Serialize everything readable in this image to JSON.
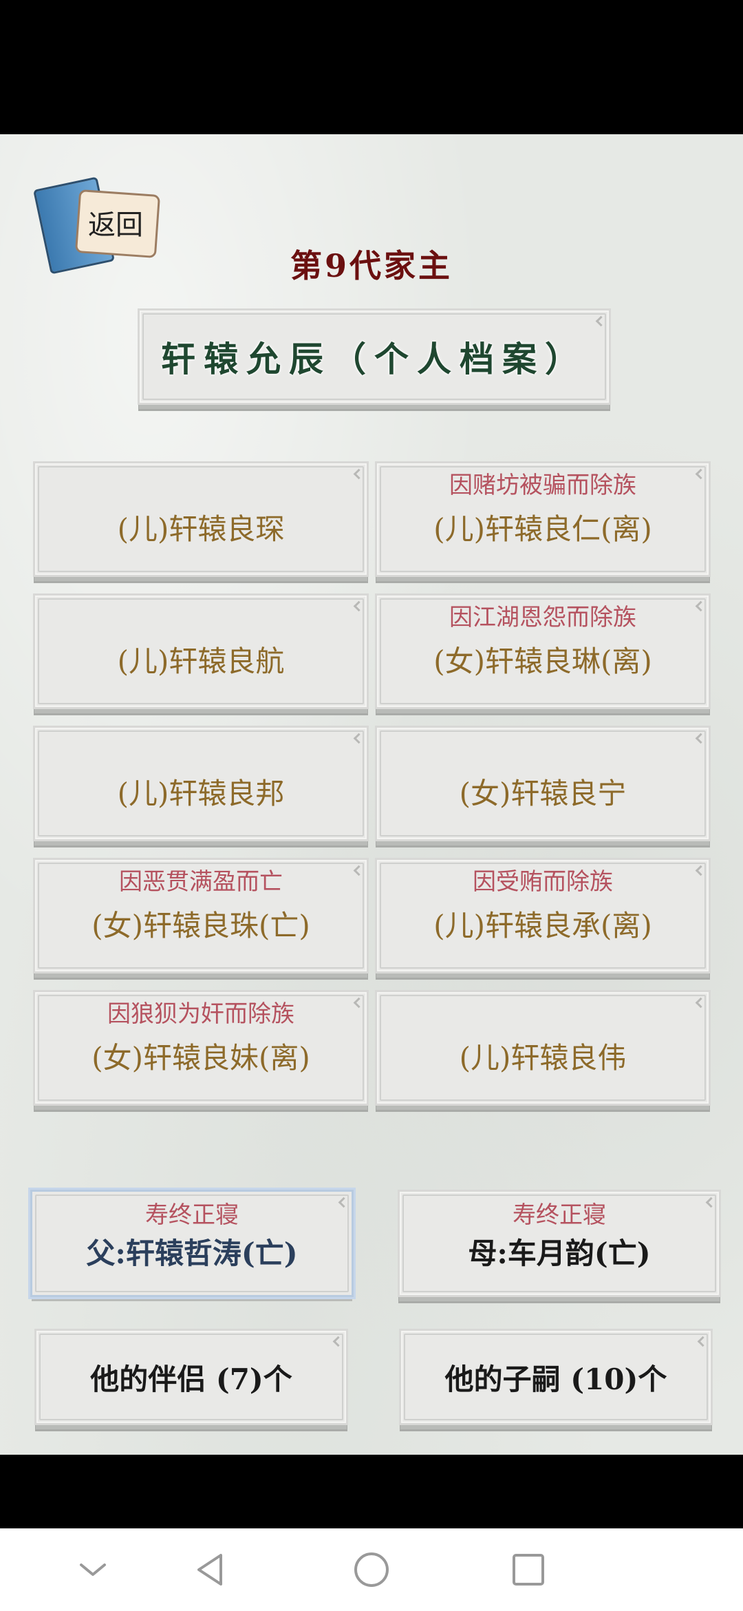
{
  "header": {
    "back_label": "返回",
    "generation_title": "第9代家主"
  },
  "profile": {
    "title": "轩辕允辰（个人档案）"
  },
  "children": [
    {
      "note": "",
      "name": "(儿)轩辕良琛"
    },
    {
      "note": "因赌坊被骗而除族",
      "name": "(儿)轩辕良仁(离)"
    },
    {
      "note": "",
      "name": "(儿)轩辕良航"
    },
    {
      "note": "因江湖恩怨而除族",
      "name": "(女)轩辕良琳(离)"
    },
    {
      "note": "",
      "name": "(儿)轩辕良邦"
    },
    {
      "note": "",
      "name": "(女)轩辕良宁"
    },
    {
      "note": "因恶贯满盈而亡",
      "name": "(女)轩辕良珠(亡)"
    },
    {
      "note": "因受贿而除族",
      "name": "(儿)轩辕良承(离)"
    },
    {
      "note": "因狼狈为奸而除族",
      "name": "(女)轩辕良妹(离)"
    },
    {
      "note": "",
      "name": "(儿)轩辕良伟"
    }
  ],
  "parents": {
    "father": {
      "note": "寿终正寝",
      "name": "父:轩辕哲涛(亡)",
      "color": "#2b3f5c"
    },
    "mother": {
      "note": "寿终正寝",
      "name": "母:车月韵(亡)",
      "color": "#1a1a1a"
    }
  },
  "actions": {
    "partners": "他的伴侣 (7)个",
    "children": "他的子嗣 (10)个"
  },
  "nav": {
    "icons": [
      "chevron-down-icon",
      "back-triangle-icon",
      "home-circle-icon",
      "recents-square-icon"
    ]
  },
  "colors": {
    "note": "#b5525f",
    "child_name": "#8d6a2a",
    "title": "#6b1010",
    "profile": "#1f4730"
  }
}
